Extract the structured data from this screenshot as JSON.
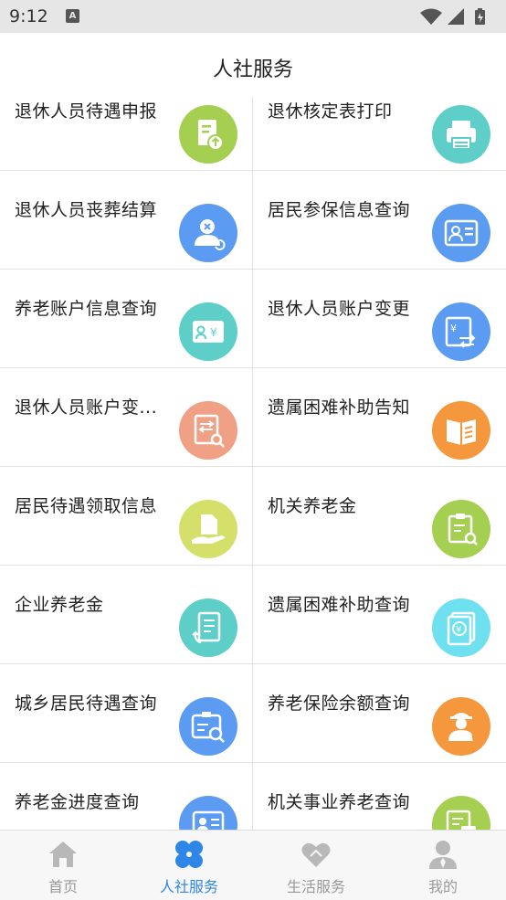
{
  "status_bar": {
    "time": "9:12",
    "notification_icon": "A"
  },
  "header": {
    "title": "人社服务"
  },
  "services": [
    {
      "label": "退休人员待遇申报",
      "icon": "document-upload-icon",
      "color": "#a4cf50"
    },
    {
      "label": "退休核定表打印",
      "icon": "printer-icon",
      "color": "#5dcfc8"
    },
    {
      "label": "退休人员丧葬结算",
      "icon": "person-cancel-icon",
      "color": "#5b9cf2"
    },
    {
      "label": "居民参保信息查询",
      "icon": "id-card-icon",
      "color": "#5b9cf2"
    },
    {
      "label": "养老账户信息查询",
      "icon": "account-yuan-icon",
      "color": "#5dcfc8"
    },
    {
      "label": "退休人员账户变更",
      "icon": "account-transfer-icon",
      "color": "#5b9cf2"
    },
    {
      "label": "退休人员账户变...",
      "icon": "document-search-icon",
      "color": "#f0a084"
    },
    {
      "label": "遗属困难补助告知",
      "icon": "open-book-icon",
      "color": "#f5973c"
    },
    {
      "label": "居民待遇领取信息",
      "icon": "hand-document-icon",
      "color": "#d4e06a"
    },
    {
      "label": "机关养老金",
      "icon": "clipboard-search-icon",
      "color": "#a4cf50"
    },
    {
      "label": "企业养老金",
      "icon": "document-refresh-icon",
      "color": "#5dcfc8"
    },
    {
      "label": "遗属困难补助查询",
      "icon": "yuan-stack-icon",
      "color": "#6ee0f0"
    },
    {
      "label": "城乡居民待遇查询",
      "icon": "card-search-icon",
      "color": "#5b9cf2"
    },
    {
      "label": "养老保险余额查询",
      "icon": "elderly-person-icon",
      "color": "#f5973c"
    },
    {
      "label": "养老金进度查询",
      "icon": "profile-card-icon",
      "color": "#5b9cf2"
    },
    {
      "label": "机关事业养老查询",
      "icon": "document-yuan-icon",
      "color": "#a4cf50"
    }
  ],
  "tabs": [
    {
      "label": "首页",
      "icon": "home-icon"
    },
    {
      "label": "人社服务",
      "icon": "four-petal-icon"
    },
    {
      "label": "生活服务",
      "icon": "heart-icon"
    },
    {
      "label": "我的",
      "icon": "user-icon"
    }
  ],
  "colors": {
    "accent": "#2e86e6",
    "tab_inactive": "#b8b8b8"
  }
}
